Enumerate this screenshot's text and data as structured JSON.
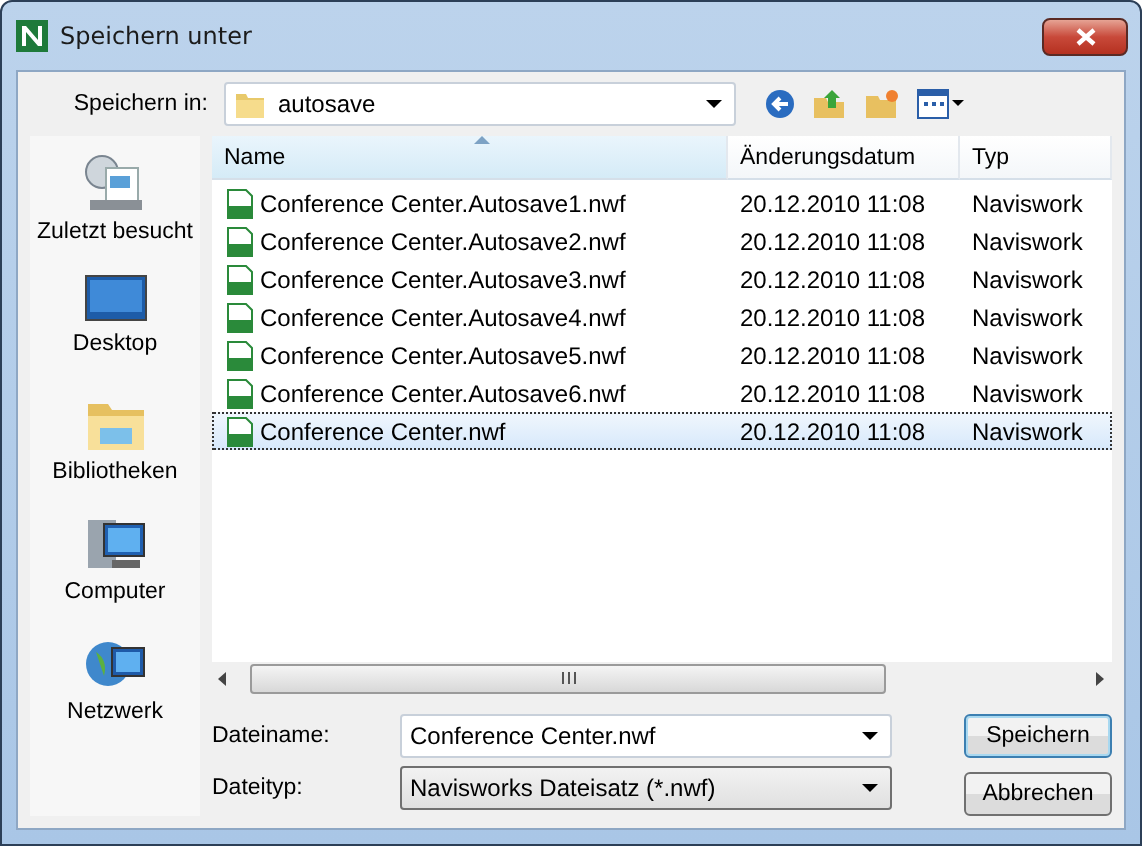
{
  "window": {
    "title": "Speichern unter"
  },
  "location": {
    "label": "Speichern in:",
    "value": "autosave"
  },
  "sidebar": {
    "items": [
      {
        "label": "Zuletzt besucht",
        "kind": "recent"
      },
      {
        "label": "Desktop",
        "kind": "desktop"
      },
      {
        "label": "Bibliotheken",
        "kind": "libraries"
      },
      {
        "label": "Computer",
        "kind": "computer"
      },
      {
        "label": "Netzwerk",
        "kind": "network"
      }
    ]
  },
  "table": {
    "columns": [
      "Name",
      "Änderungsdatum",
      "Typ"
    ],
    "rows": [
      {
        "name": "Conference Center.Autosave1.nwf",
        "date": "20.12.2010 11:08",
        "type": "Naviswork",
        "selected": false
      },
      {
        "name": "Conference Center.Autosave2.nwf",
        "date": "20.12.2010 11:08",
        "type": "Naviswork",
        "selected": false
      },
      {
        "name": "Conference Center.Autosave3.nwf",
        "date": "20.12.2010 11:08",
        "type": "Naviswork",
        "selected": false
      },
      {
        "name": "Conference Center.Autosave4.nwf",
        "date": "20.12.2010 11:08",
        "type": "Naviswork",
        "selected": false
      },
      {
        "name": "Conference Center.Autosave5.nwf",
        "date": "20.12.2010 11:08",
        "type": "Naviswork",
        "selected": false
      },
      {
        "name": "Conference Center.Autosave6.nwf",
        "date": "20.12.2010 11:08",
        "type": "Naviswork",
        "selected": false
      },
      {
        "name": "Conference Center.nwf",
        "date": "20.12.2010 11:08",
        "type": "Naviswork",
        "selected": true
      }
    ]
  },
  "filename": {
    "label": "Dateiname:",
    "value": "Conference Center.nwf"
  },
  "filetype": {
    "label": "Dateityp:",
    "value": "Navisworks Dateisatz (*.nwf)"
  },
  "buttons": [
    "Speichern",
    "Abbrechen"
  ]
}
